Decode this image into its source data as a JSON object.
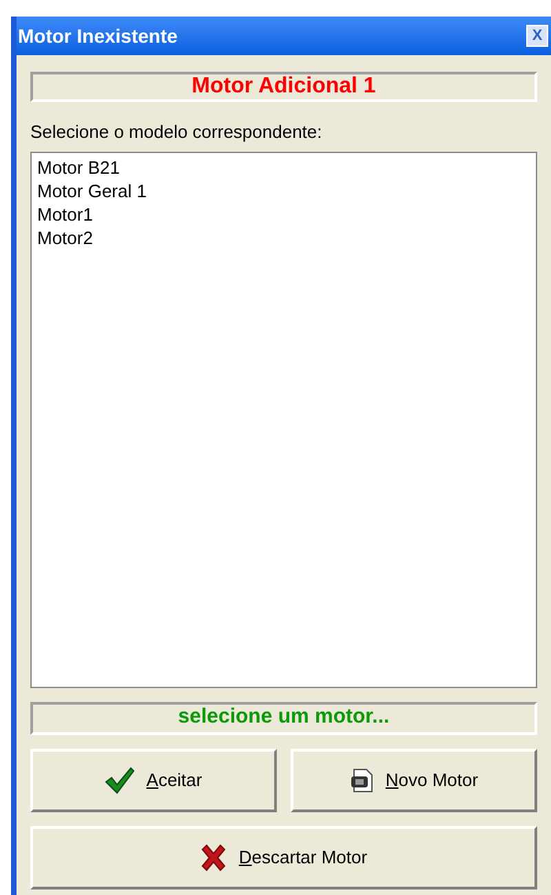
{
  "window": {
    "title": "Motor Inexistente",
    "close": "X"
  },
  "header": "Motor Adicional 1",
  "prompt": "Selecione o modelo correspondente:",
  "models": [
    "Motor B21",
    "Motor Geral 1",
    "Motor1",
    "Motor2"
  ],
  "status": "selecione um motor...",
  "buttons": [
    {
      "label": "Aceitar",
      "kind": "accept"
    },
    {
      "label": "Novo Motor",
      "kind": "new"
    },
    {
      "label": "Descartar Motor",
      "kind": "discard"
    }
  ]
}
